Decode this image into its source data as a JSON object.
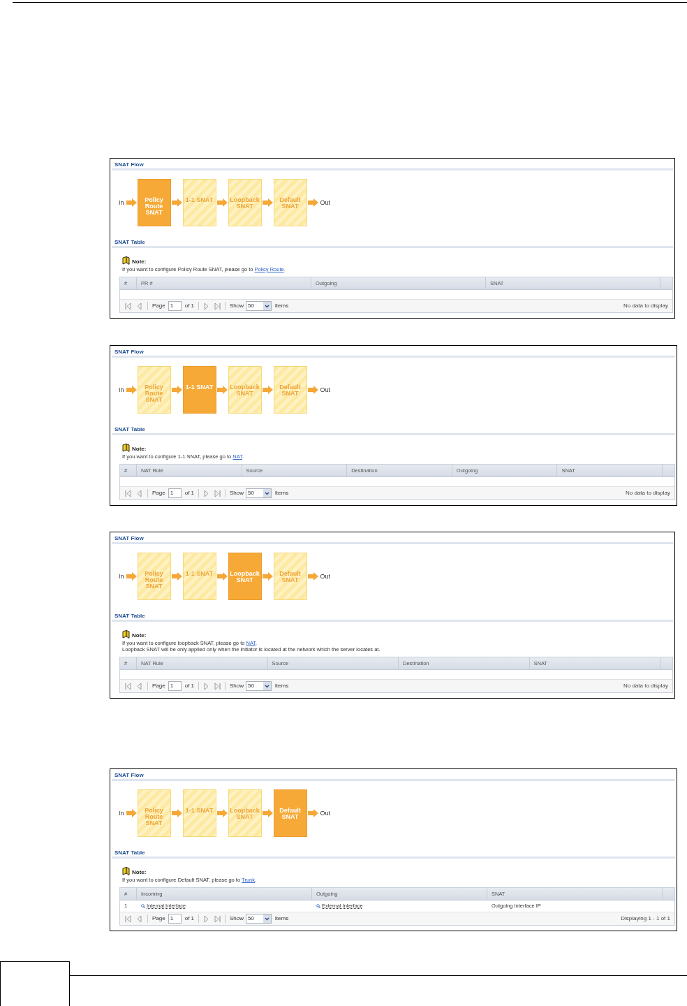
{
  "panels": [
    {
      "flow_title": "SNAT Flow",
      "flow": {
        "start": "In",
        "end": "Out",
        "steps": [
          {
            "label": "Policy Route SNAT",
            "selected": true
          },
          {
            "label": "1-1 SNAT",
            "selected": false
          },
          {
            "label": "Loopback SNAT",
            "selected": false
          },
          {
            "label": "Default SNAT",
            "selected": false
          }
        ]
      },
      "table_title": "SNAT Table",
      "note": {
        "title": "Note:",
        "lines": [
          {
            "text": "If you want to configure Policy Route SNAT, please go to ",
            "link": "Policy Route",
            "after": "."
          }
        ]
      },
      "table": {
        "columns": [
          "#",
          "PR #",
          "Outgoing",
          "SNAT"
        ]
      },
      "pager": {
        "page_label": "Page",
        "page": "1",
        "page_count": "of 1",
        "show_label": "Show",
        "per_page": "50",
        "items_label": "items",
        "status": "No data to display"
      }
    },
    {
      "flow_title": "SNAT Flow",
      "flow": {
        "start": "In",
        "end": "Out",
        "steps": [
          {
            "label": "Policy Route SNAT",
            "selected": false
          },
          {
            "label": "1-1 SNAT",
            "selected": true
          },
          {
            "label": "Loopback SNAT",
            "selected": false
          },
          {
            "label": "Default SNAT",
            "selected": false
          }
        ]
      },
      "table_title": "SNAT Table",
      "note": {
        "title": "Note:",
        "lines": [
          {
            "text": "If you want to configure 1-1 SNAT, please go to ",
            "link": "NAT",
            "after": "."
          }
        ]
      },
      "table": {
        "columns": [
          "#",
          "NAT Rule",
          "Source",
          "Destination",
          "Outgoing",
          "SNAT"
        ]
      },
      "pager": {
        "page_label": "Page",
        "page": "1",
        "page_count": "of 1",
        "show_label": "Show",
        "per_page": "50",
        "items_label": "items",
        "status": "No data to display"
      }
    },
    {
      "flow_title": "SNAT Flow",
      "flow": {
        "start": "In",
        "end": "Out",
        "steps": [
          {
            "label": "Policy Route SNAT",
            "selected": false
          },
          {
            "label": "1-1 SNAT",
            "selected": false
          },
          {
            "label": "Loopback SNAT",
            "selected": true
          },
          {
            "label": "Default SNAT",
            "selected": false
          }
        ]
      },
      "table_title": "SNAT Table",
      "note": {
        "title": "Note:",
        "lines": [
          {
            "text": "If you want to configure loopback SNAT, please go to ",
            "link": "NAT",
            "after": "."
          },
          {
            "text": "Loopback SNAT will be only applied only when the initiator is located at the network which the server locates at."
          }
        ]
      },
      "table": {
        "columns": [
          "#",
          "NAT Rule",
          "Source",
          "Destination",
          "SNAT"
        ]
      },
      "pager": {
        "page_label": "Page",
        "page": "1",
        "page_count": "of 1",
        "show_label": "Show",
        "per_page": "50",
        "items_label": "items",
        "status": "No data to display"
      }
    },
    {
      "flow_title": "SNAT Flow",
      "flow": {
        "start": "In",
        "end": "Out",
        "steps": [
          {
            "label": "Policy Route SNAT",
            "selected": false
          },
          {
            "label": "1-1 SNAT",
            "selected": false
          },
          {
            "label": "Loopback SNAT",
            "selected": false
          },
          {
            "label": "Default SNAT",
            "selected": true
          }
        ]
      },
      "table_title": "SNAT Table",
      "note": {
        "title": "Note:",
        "lines": [
          {
            "text": "If you want to configure Default SNAT, please go to ",
            "link": "Trunk",
            "after": "."
          }
        ]
      },
      "table": {
        "columns": [
          "#",
          "Incoming",
          "Outgoing",
          "SNAT"
        ],
        "rows": [
          {
            "cells": [
              {
                "kind": "text",
                "text": "1"
              },
              {
                "kind": "link",
                "text": "Internal Interface"
              },
              {
                "kind": "link",
                "text": "External Interface"
              },
              {
                "kind": "text",
                "text": "Outgoing Interface IP"
              }
            ]
          }
        ]
      },
      "pager": {
        "page_label": "Page",
        "page": "1",
        "page_count": "of 1",
        "show_label": "Show",
        "per_page": "50",
        "items_label": "items",
        "status": "Displaying 1 - 1 of 1"
      }
    }
  ]
}
